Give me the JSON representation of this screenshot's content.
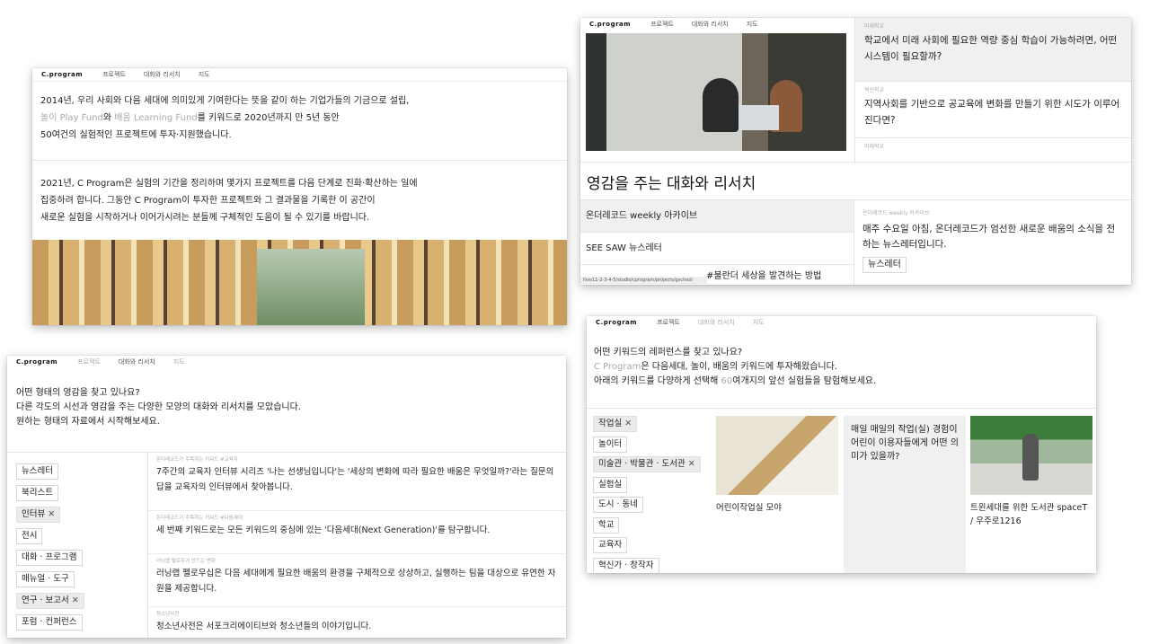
{
  "nav": {
    "logo": "C.program",
    "projects": "프로젝트",
    "talks": "대화와 리서치",
    "map": "지도"
  },
  "card_a": {
    "p1_line1": "2014년, 우리 사회와 다음 세대에 의미있게 기여한다는 뜻을 같이 하는 기업가들의 기금으로 설립,",
    "p1_line2_fund1": "놀이 Play Fund",
    "p1_line2_mid": "와 ",
    "p1_line2_fund2": "배움 Learning Fund",
    "p1_line2_rest": "를 키워드로 2020년까지 만 5년 동안",
    "p1_line3": "50여건의 실험적인 프로젝트에 투자·지원했습니다.",
    "p2_line1": "2021년, C Program은 실험의 기간을 정리하며 몇가지 프로젝트를 다음 단계로 진화·확산하는 일에",
    "p2_line2": "집중하려 합니다. 그동안 C Program이 투자한 프로젝트와 그 결과물을 기록한 이 공간이",
    "p2_line3": "새로운 실험을 시작하거나 이어가시려는 분들께 구체적인 도움이 될 수 있기를 바랍니다."
  },
  "card_b": {
    "q1_tag": "미래학교",
    "q1": "학교에서 미래 사회에 필요한 역량 중심 학습이 가능하려면, 어떤 시스템이 필요할까?",
    "q2_tag": "혁신학교",
    "q2": "지역사회를 기반으로 공교육에 변화를 만들기 위한 시도가 이루어진다면?",
    "q3_tag": "미래학교",
    "heading": "영감을 주는 대화와 리서치",
    "tabs": [
      "온더레코드 weekly 아카이브",
      "SEE SAW 뉴스레터",
      "#불란더 세상을 발견하는 방법"
    ],
    "status_url": "live/L1-2-3-4-5/studio/cprogram/projects/gschool",
    "news_tag": "온더레코드 weekly 아카이브",
    "news_text": "매주 수요일 아침, 온더레코드가 엄선한 새로운 배움의 소식을 전하는 뉴스레터입니다.",
    "news_chip": "뉴스레터"
  },
  "card_c": {
    "line1": "어떤 형태의 영감을 찾고 있나요?",
    "line2": "다른 각도의 시선과 영감을 주는 다양한 모양의 대화와 리서치를 모았습니다.",
    "line3": "원하는 형태의 자료에서 시작해보세요.",
    "filters": [
      {
        "label": "뉴스레터",
        "on": false
      },
      {
        "label": "북리스트",
        "on": false
      },
      {
        "label": "인터뷰",
        "on": true
      },
      {
        "label": "전시",
        "on": false
      },
      {
        "label": "대화 · 프로그램",
        "on": false
      },
      {
        "label": "매뉴얼 · 도구",
        "on": false
      },
      {
        "label": "연구 · 보고서",
        "on": true
      },
      {
        "label": "포럼 · 컨퍼런스",
        "on": false
      }
    ],
    "rows": [
      {
        "tag": "온더레코드가 주목하는 키워드 #교육자",
        "text": "7주간의 교육자 인터뷰 시리즈 '나는 선생님입니다'는 '세상의 변화에 따라 필요한 배움은 무엇일까?'라는 질문의 답을 교육자의 인터뷰에서 찾아봅니다."
      },
      {
        "tag": "온더레코드가 주목하는 키워드 #다음세대",
        "text": "세 번째 키워드로는 모든 키워드의 중심에 있는 '다음세대(Next Generation)'를 탐구합니다."
      },
      {
        "tag": "러닝랩 펠로우가 만드는 변화",
        "text": "러닝랩 펠로우십은 다음 세대에게 필요한 배움의 환경을 구체적으로 상상하고, 실행하는 팀을 대상으로 유연한 자원을 제공합니다."
      },
      {
        "tag": "청소년사전",
        "text": "청소년사전은 서포크리에이티브와 청소년들의 이야기입니다."
      }
    ]
  },
  "card_d": {
    "line1": "어떤 키워드의 레퍼런스를 찾고 있나요?",
    "line2_hl": "C Program",
    "line2_rest": "은 다음세대, 놀이, 배움의 키워드에 투자해왔습니다.",
    "line3_a": "아래의 키워드를 다양하게 선택해 ",
    "line3_hl": "60",
    "line3_b": "여개지의 앞선 실험들을 탐험해보세요.",
    "keywords": [
      {
        "label": "작업실",
        "on": true
      },
      {
        "label": "놀이터",
        "on": false
      },
      {
        "label": "미술관 · 박물관 · 도서관",
        "on": true
      },
      {
        "label": "실험실",
        "on": false
      },
      {
        "label": "도시 · 동네",
        "on": false
      },
      {
        "label": "학교",
        "on": false
      },
      {
        "label": "교육자",
        "on": false
      },
      {
        "label": "혁신가 · 창작자",
        "on": false
      }
    ],
    "tile1": "어린이작업실 모야",
    "tile2": "매일 매일의 작업(실) 경험이 어린이 이용자들에게 어떤 의미가 있을까?",
    "tile3": "트윈세대를 위한 도서관 spaceT / 우주로1216"
  },
  "colors": {
    "accent_gray": "#aaaaaa",
    "chip_active": "#ebebeb"
  }
}
